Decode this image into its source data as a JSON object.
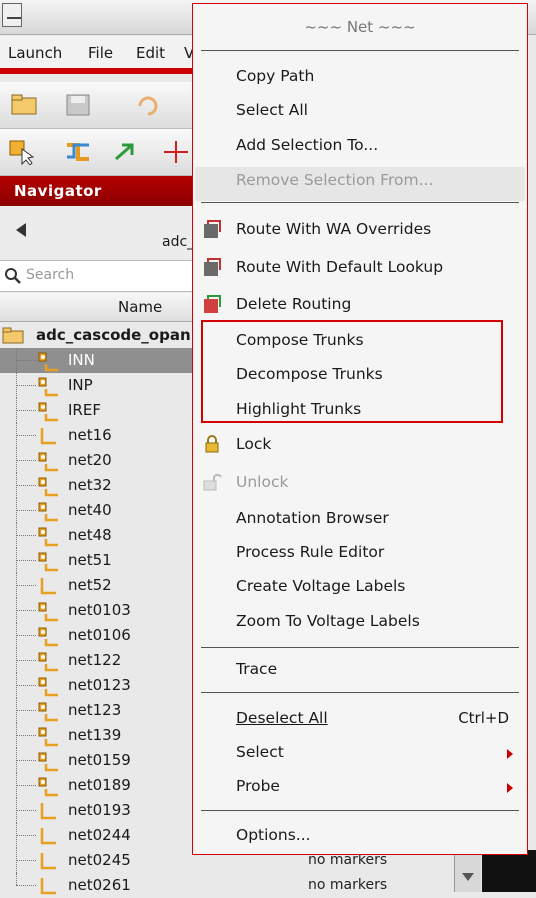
{
  "app": {
    "menubar": [
      "Launch",
      "File",
      "Edit",
      "V"
    ],
    "navigator_title": "Navigator",
    "nav_path": "adc_",
    "search_placeholder": "Search",
    "column_name": "Name",
    "tree_root": "adc_cascode_opan",
    "nets": [
      {
        "name": "INN",
        "icon": "pin-net-icon",
        "selected": true
      },
      {
        "name": "INP",
        "icon": "pin-net-icon"
      },
      {
        "name": "IREF",
        "icon": "pin-net-icon"
      },
      {
        "name": "net16",
        "icon": "wire-net-icon"
      },
      {
        "name": "net20",
        "icon": "pin-net-icon"
      },
      {
        "name": "net32",
        "icon": "pin-net-icon"
      },
      {
        "name": "net40",
        "icon": "pin-net-icon"
      },
      {
        "name": "net48",
        "icon": "pin-net-icon"
      },
      {
        "name": "net51",
        "icon": "pin-net-icon"
      },
      {
        "name": "net52",
        "icon": "wire-net-icon"
      },
      {
        "name": "net0103",
        "icon": "pin-net-icon"
      },
      {
        "name": "net0106",
        "icon": "pin-net-icon"
      },
      {
        "name": "net122",
        "icon": "pin-net-icon"
      },
      {
        "name": "net0123",
        "icon": "pin-net-icon"
      },
      {
        "name": "net123",
        "icon": "pin-net-icon"
      },
      {
        "name": "net139",
        "icon": "pin-net-icon"
      },
      {
        "name": "net0159",
        "icon": "pin-net-icon"
      },
      {
        "name": "net0189",
        "icon": "pin-net-icon"
      },
      {
        "name": "net0193",
        "icon": "wire-net-icon"
      },
      {
        "name": "net0244",
        "icon": "wire-net-icon"
      },
      {
        "name": "net0245",
        "icon": "wire-net-icon"
      },
      {
        "name": "net0261",
        "icon": "wire-net-icon"
      }
    ],
    "markers_text": "no markers"
  },
  "context_menu": {
    "header": "~~~ Net ~~~",
    "items": {
      "copy_path": "Copy Path",
      "select_all": "Select All",
      "add_selection_to": "Add Selection To...",
      "remove_selection_from": "Remove Selection From...",
      "route_wa_overrides": "Route With WA Overrides",
      "route_default_lookup": "Route With Default Lookup",
      "delete_routing": "Delete Routing",
      "compose_trunks": "Compose Trunks",
      "decompose_trunks": "Decompose Trunks",
      "highlight_trunks": "Highlight Trunks",
      "lock": "Lock",
      "unlock": "Unlock",
      "annotation_browser": "Annotation Browser",
      "process_rule_editor": "Process Rule Editor",
      "create_voltage_labels": "Create Voltage Labels",
      "zoom_voltage_labels": "Zoom To Voltage Labels",
      "trace": "Trace",
      "deselect_all": "Deselect All",
      "deselect_all_shortcut": "Ctrl+D",
      "select": "Select",
      "probe": "Probe",
      "options": "Options..."
    }
  },
  "colors": {
    "accent_red": "#d40000",
    "navigator_red": "#a00000"
  }
}
